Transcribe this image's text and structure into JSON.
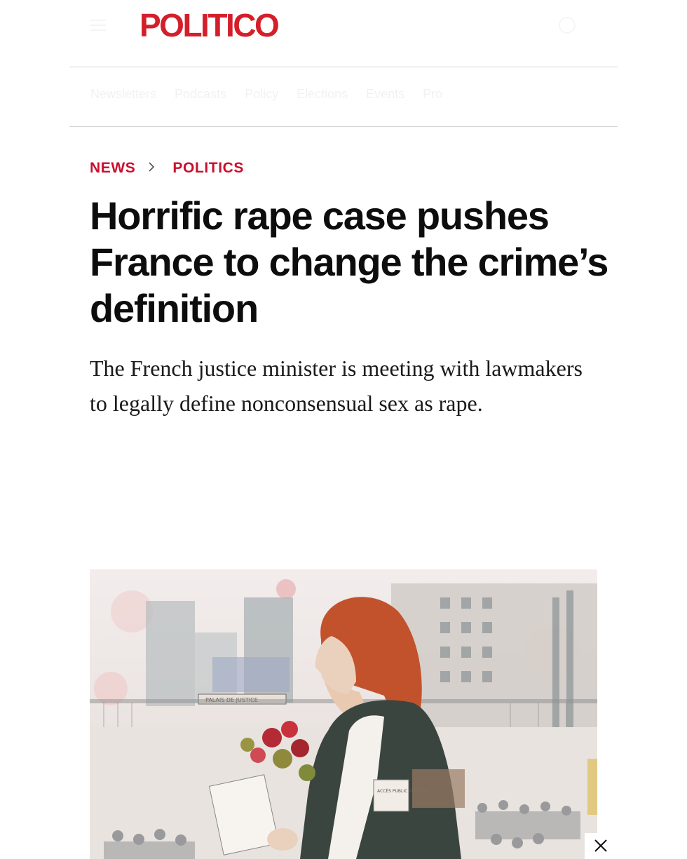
{
  "header": {
    "logo": "POLITICO",
    "menu_icon": "hamburger-menu-icon",
    "account_icon": "user-icon"
  },
  "subnav": {
    "items": [
      "Newsletters",
      "Podcasts",
      "Policy",
      "Elections",
      "Events",
      "Pro"
    ]
  },
  "breadcrumb": {
    "section": "NEWS",
    "subsection": "POLITICS",
    "separator_icon": "chevron-right-icon"
  },
  "article": {
    "headline": "Horrific rape case pushes France to change the crime’s definition",
    "dek": "The French justice minister is meeting with lawmakers to legally define nonconsensual sex as rape."
  },
  "hero": {
    "sign_text": "PALAIS DE JUSTICE",
    "notice_text": "ACCÈS PUBLIC INTERDIT",
    "close_icon": "close-icon"
  },
  "colors": {
    "brand": "#d41f2b",
    "section": "#c8102e",
    "text": "#0d0d0d"
  }
}
